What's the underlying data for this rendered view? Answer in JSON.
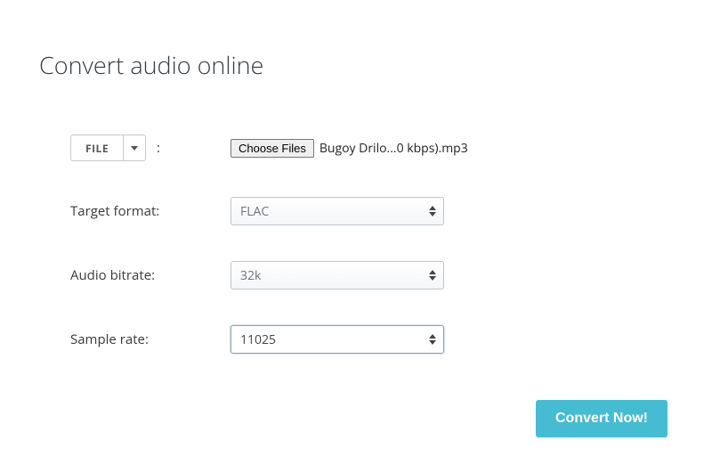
{
  "title": "Convert audio online",
  "file_row": {
    "button_label": "FILE",
    "choose_label": "Choose Files",
    "filename": "Bugoy Drilo...0 kbps).mp3"
  },
  "target_format": {
    "label": "Target format:",
    "value": "FLAC"
  },
  "audio_bitrate": {
    "label": "Audio bitrate:",
    "value": "32k"
  },
  "sample_rate": {
    "label": "Sample rate:",
    "value": "11025"
  },
  "convert_label": "Convert Now!"
}
